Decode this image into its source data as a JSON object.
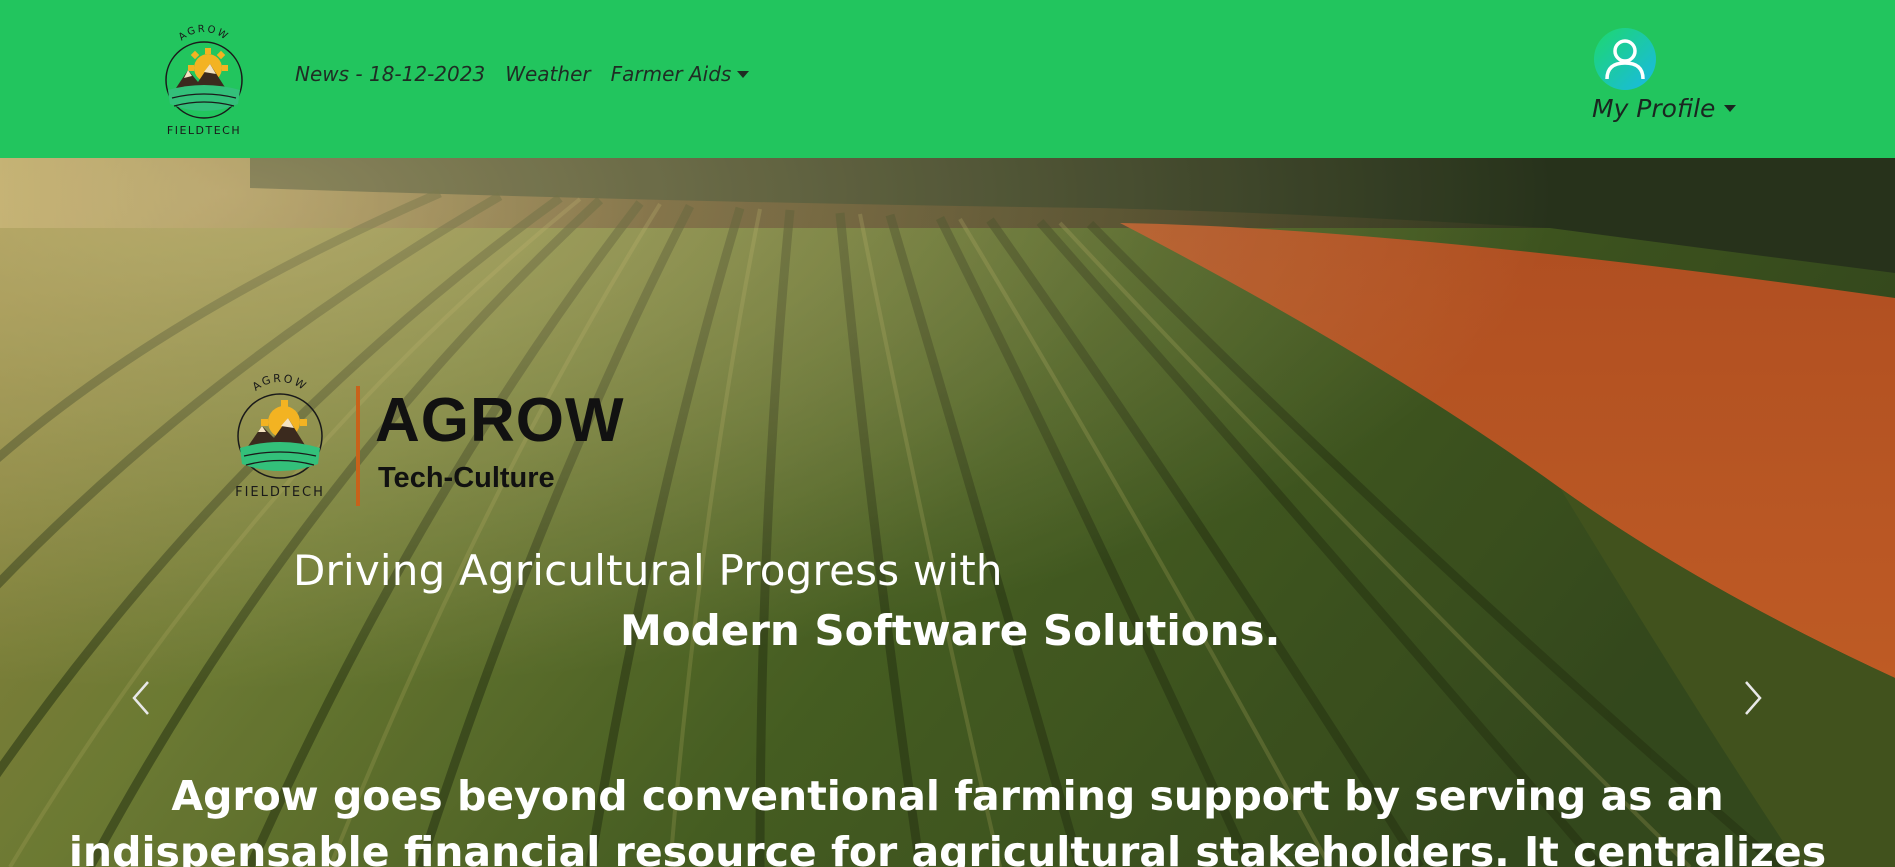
{
  "brand": {
    "logo_top_text": "AGROW",
    "logo_bottom_text": "FIELDTECH"
  },
  "nav": {
    "items": [
      {
        "label": "News - 18-12-2023",
        "dropdown": false
      },
      {
        "label": "Weather",
        "dropdown": false
      },
      {
        "label": "Farmer Aids",
        "dropdown": true
      }
    ],
    "profile_label": "My Profile"
  },
  "hero": {
    "logo_top_text": "AGROW",
    "logo_bottom_text": "FIELDTECH",
    "brand_name": "AGROW",
    "brand_tag": "Tech-Culture",
    "tagline_line1": "Driving Agricultural Progress with",
    "tagline_line2": "Modern Software Solutions.",
    "description_line1": "Agrow goes beyond conventional farming support by serving as an",
    "description_line2": "indispensable financial resource for agricultural stakeholders. It centralizes"
  },
  "colors": {
    "navbar": "#22c55e",
    "accent_divider": "#c8621a",
    "avatar_gradient_start": "#1ed86d",
    "avatar_gradient_end": "#19b8e6"
  },
  "icons": {
    "profile": "user-icon",
    "prev": "chevron-left-icon",
    "next": "chevron-right-icon"
  }
}
